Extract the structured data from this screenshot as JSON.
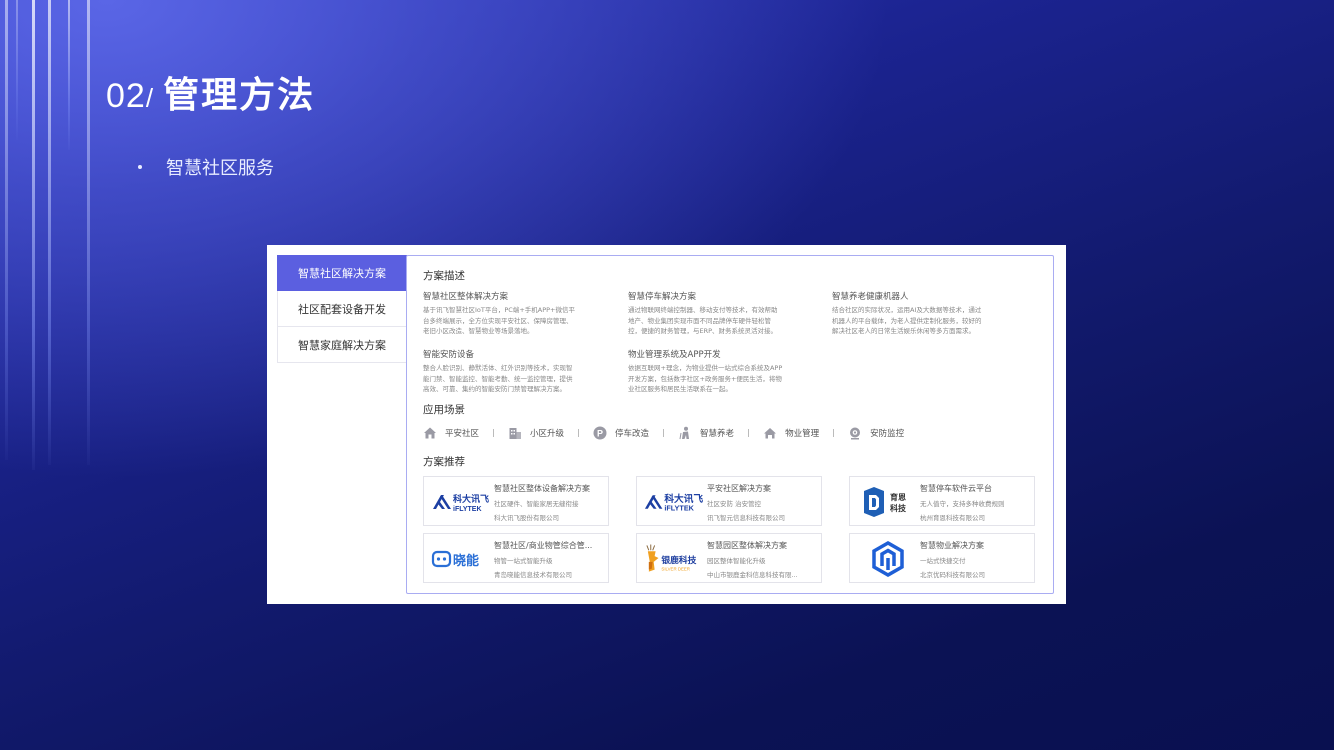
{
  "slide": {
    "number": "02",
    "slash": "/",
    "title": "管理方法",
    "bullet": "智慧社区服务"
  },
  "tabs": [
    {
      "label": "智慧社区解决方案",
      "active": true
    },
    {
      "label": "社区配套设备开发",
      "active": false
    },
    {
      "label": "智慧家庭解决方案",
      "active": false
    }
  ],
  "description": {
    "heading": "方案描述",
    "items": [
      {
        "title": "智慧社区整体解决方案",
        "lines": [
          "基于讯飞智慧社区IoT平台，PC端+手机APP+微信平",
          "台多终端展示，全方位实现平安社区、保障房管理、",
          "老旧小区改造、智慧物业等场景落地。"
        ]
      },
      {
        "title": "智慧停车解决方案",
        "lines": [
          "通过物联网终端控制器、移动支付等技术，有效帮助",
          "地产、物业集团实现市面不同品牌停车硬件轻松管",
          "控，便捷的财务管理，与ERP、财务系统灵活对接。"
        ]
      },
      {
        "title": "智慧养老健康机器人",
        "lines": [
          "结合社区的实际状况，运用AI及大数据等技术，通过",
          "机器人的平台载体，为老人提供定制化服务，较好的",
          "解决社区老人的日常生活娱乐休闲等多方面需求。"
        ]
      },
      {
        "title": "智能安防设备",
        "lines": [
          "整合人脸识别、静默活体、红外识别等技术，实现智",
          "能门禁、智能监控、智能考勤、统一监控管理，提供",
          "高效、可靠、集约的智能安防门禁管理解决方案。"
        ]
      },
      {
        "title": "物业管理系统及APP开发",
        "lines": [
          "依据互联网+理念，为物业提供一站式综合系统及APP",
          "开发方案，包括数字社区+政务服务+便民生活，将物",
          "业社区服务和居民生活联系在一起。"
        ]
      }
    ]
  },
  "scenes": {
    "heading": "应用场景",
    "items": [
      {
        "label": "平安社区",
        "icon": "house-icon"
      },
      {
        "label": "小区升级",
        "icon": "building-icon"
      },
      {
        "label": "停车改造",
        "icon": "parking-icon"
      },
      {
        "label": "智慧养老",
        "icon": "elder-icon"
      },
      {
        "label": "物业管理",
        "icon": "home-icon"
      },
      {
        "label": "安防监控",
        "icon": "camera-icon"
      }
    ]
  },
  "recommend": {
    "heading": "方案推荐",
    "items": [
      {
        "title": "智慧社区整体设备解决方案",
        "sub": "社区硬件、智能家居无缝衔接",
        "company": "科大讯飞股份有限公司",
        "logo_text": "科大讯飞",
        "logo_sub": "iFLYTEK",
        "logo": "iflytek-logo"
      },
      {
        "title": "平安社区解决方案",
        "sub": "社区安防 治安管控",
        "company": "讯飞智元信息科技有限公司",
        "logo_text": "科大讯飞",
        "logo_sub": "iFLYTEK",
        "logo": "iflytek-logo"
      },
      {
        "title": "智慧停车软件云平台",
        "sub": "无人值守，支持多种收费规则",
        "company": "杭州育恩科技有限公司",
        "logo_text": "育恩",
        "logo_sub": "科技",
        "logo": "yuen-logo"
      },
      {
        "title": "智慧社区/商业物管综合管...",
        "sub": "物管一站式智能升级",
        "company": "青岛晓能信息技术有限公司",
        "logo_text": "晓能",
        "logo_sub": "",
        "logo": "xiaoneng-logo"
      },
      {
        "title": "智慧园区整体解决方案",
        "sub": "园区整体智能化升级",
        "company": "中山市银鹿金科信息科技有限...",
        "logo_text": "银鹿科技",
        "logo_sub": "SILVER DEER",
        "logo": "silver-deer-logo"
      },
      {
        "title": "智慧物业解决方案",
        "sub": "一站式快捷交付",
        "company": "北京优码科技有限公司",
        "logo_text": "",
        "logo_sub": "",
        "logo": "youma-logo"
      }
    ]
  },
  "colors": {
    "accent": "#5b5fe0",
    "panel_border": "#a9acf2",
    "iflytek_blue": "#1c3fa3",
    "yuen_blue": "#1f5fb5",
    "xiaoneng_blue": "#2a6fd6",
    "silver_deer_orange": "#f0a020",
    "youma_blue": "#1e5fd6"
  }
}
